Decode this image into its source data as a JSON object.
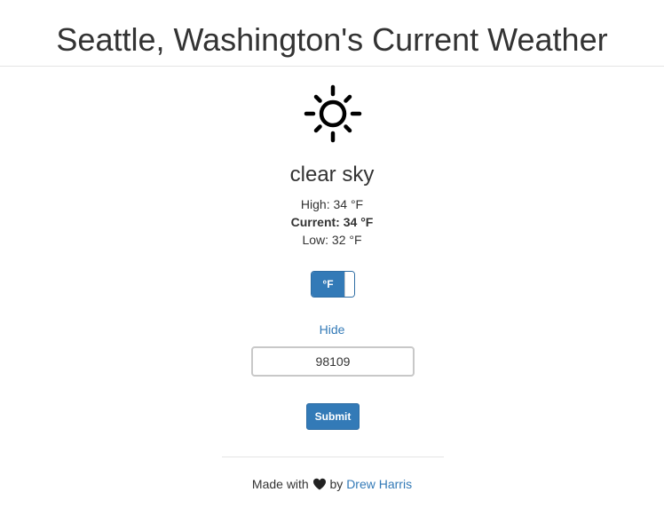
{
  "header": {
    "title": "Seattle, Washington's Current Weather"
  },
  "weather": {
    "icon": "sun-icon",
    "condition": "clear sky",
    "high": "High: 34 °F",
    "current": "Current: 34 °F",
    "low": "Low: 32 °F"
  },
  "unit_toggle": {
    "label": "°F",
    "state": "on"
  },
  "hide_link": "Hide",
  "zip_input": {
    "value": "98109"
  },
  "submit_label": "Submit",
  "footer": {
    "prefix": "Made with",
    "icon": "heart-icon",
    "middle": "by",
    "author": "Drew Harris"
  },
  "colors": {
    "primary": "#337ab7",
    "text": "#333333",
    "divider": "#e5e5e5"
  }
}
